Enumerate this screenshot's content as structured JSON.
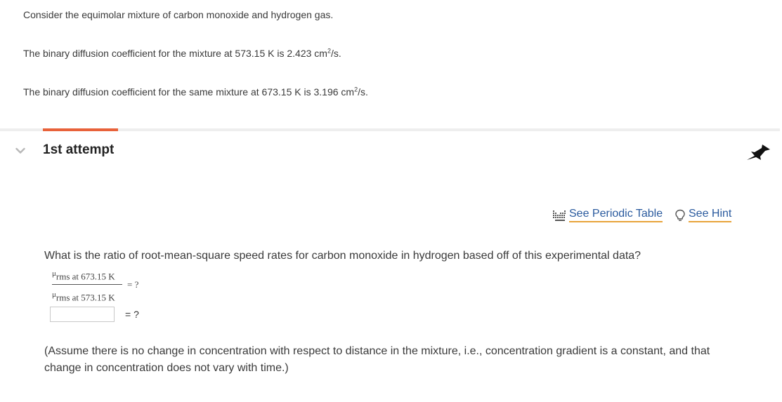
{
  "intro": {
    "line1": "Consider the equimolar mixture of carbon monoxide and hydrogen gas.",
    "line2_prefix": "The binary diffusion coefficient for the mixture at 573.15 K is 2.423 cm",
    "line2_sup": "2",
    "line2_suffix": "/s.",
    "line3_prefix": "The binary diffusion coefficient for the same mixture at 673.15 K is 3.196 cm",
    "line3_sup": "2",
    "line3_suffix": "/s."
  },
  "attempt": {
    "title": "1st attempt"
  },
  "tools": {
    "periodic_table": "See Periodic Table",
    "hint": "See Hint"
  },
  "question": {
    "text": "What is the ratio of root-mean-square speed rates for carbon monoxide in hydrogen based off of this experimental data?",
    "fraction": {
      "symbol": "μ",
      "num_sub": "rms at 673.15 K",
      "den_sub": "rms at 573.15 K",
      "equals": "= ?"
    },
    "answer": {
      "value": "",
      "equals": "= ?"
    },
    "assumption": "(Assume there is no change in concentration with respect to distance in the mixture, i.e., concentration gradient is a constant, and that change in concentration does not vary with time.)"
  },
  "colors": {
    "accent_tab": "#e8623a",
    "link": "#2a5a9e",
    "link_underline": "#e8a43a",
    "text": "#3a3a3a"
  },
  "icons": {
    "collapse": "chevron-down-icon",
    "pin": "pin-icon",
    "periodic_table": "periodic-table-icon",
    "hint": "lightbulb-icon"
  }
}
